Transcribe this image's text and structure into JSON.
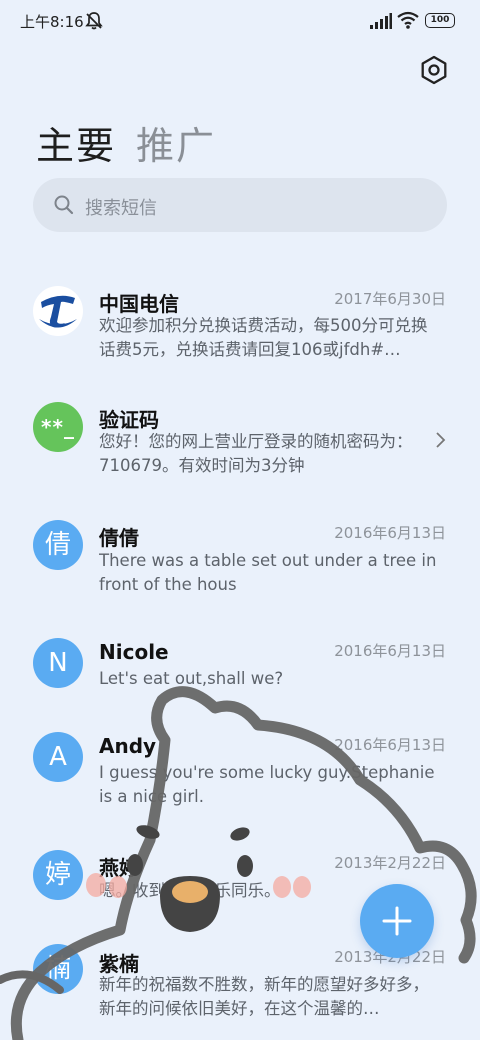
{
  "status_bar": {
    "time": "上午8:16",
    "battery": "100",
    "icons": [
      "mute-icon",
      "signal-icon",
      "wifi-icon",
      "battery-icon"
    ]
  },
  "header": {
    "settings_icon": "settings-hex-icon",
    "tab_primary": "主要",
    "tab_promo": "推广"
  },
  "search": {
    "placeholder": "搜索短信",
    "icon": "search-icon"
  },
  "conversations": [
    {
      "name": "中国电信",
      "date": "2017年6月30日",
      "preview": "欢迎参加积分兑换话费活动，每500分可兑换话费5元，兑换话费请回复106或jfdh#…",
      "avatar": "",
      "avatar_type": "telecom-logo"
    },
    {
      "name": "验证码",
      "date": "",
      "preview": "您好！您的网上营业厅登录的随机密码为：710679。有效时间为3分钟",
      "avatar": "**_",
      "avatar_type": "green"
    },
    {
      "name": "倩倩",
      "date": "2016年6月13日",
      "preview": "There was a table set out under a tree in front of the hous",
      "avatar": "倩",
      "avatar_type": "blue"
    },
    {
      "name": "Nicole",
      "date": "2016年6月13日",
      "preview": "Let's eat out,shall we?",
      "avatar": "N",
      "avatar_type": "blue"
    },
    {
      "name": "Andy",
      "date": "2016年6月13日",
      "preview": "I guess you're some lucky guy.Stephanie is a nice girl.",
      "avatar": "A",
      "avatar_type": "blue"
    },
    {
      "name": "燕婷",
      "date": "2013年2月22日",
      "preview": "嗯。收到啦。同乐同乐。",
      "avatar": "婷",
      "avatar_type": "blue"
    },
    {
      "name": "紫楠",
      "date": "2013年2月22日",
      "preview": "新年的祝福数不胜数，新年的愿望好多好多，新年的问候依旧美好，在这个温馨的…",
      "avatar": "楠",
      "avatar_type": "blue"
    }
  ],
  "fab": {
    "icon": "plus-icon"
  },
  "colors": {
    "background": "#eaf1fb",
    "accent": "#5aabf2",
    "verification_avatar": "#65c45b",
    "search_bg": "#dde4ee"
  }
}
